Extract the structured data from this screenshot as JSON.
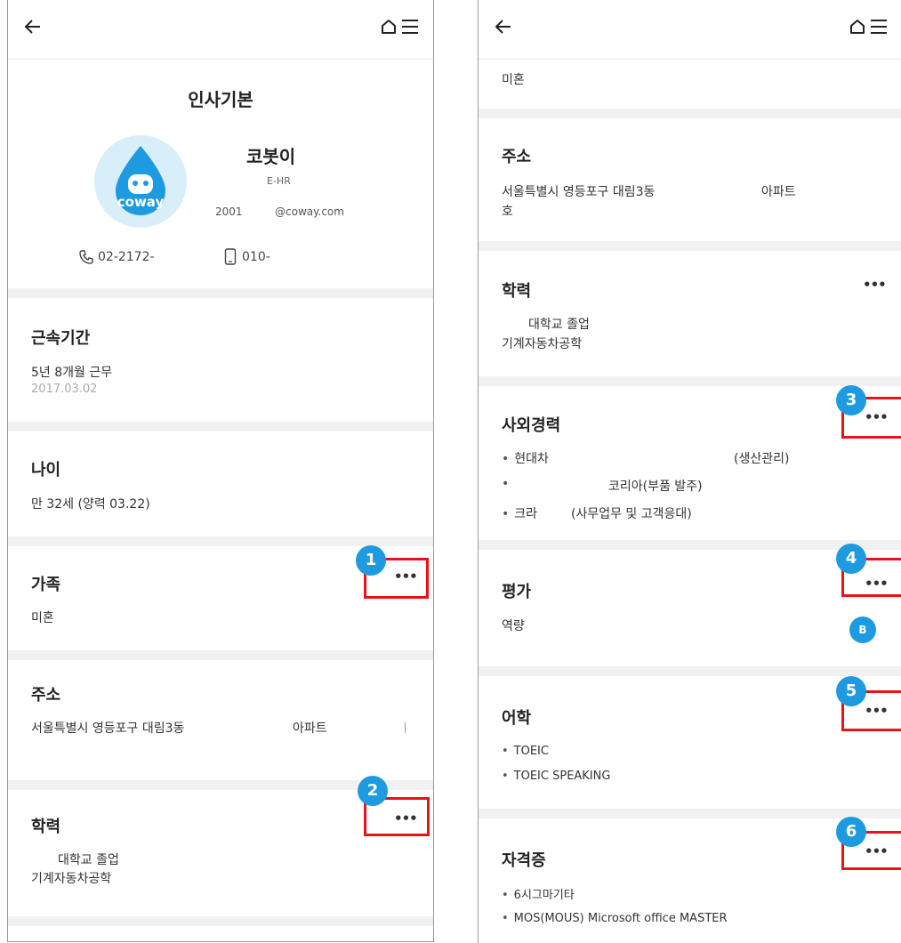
{
  "page_title": "인사기본",
  "profile": {
    "name": "코봇이",
    "dept": "E-HR",
    "emp_no": "2001",
    "email": "@coway.com",
    "phone": "02-2172-",
    "mobile": "010-",
    "logo_text": "coway"
  },
  "sections": {
    "tenure": {
      "title": "근속기간",
      "value": "5년 8개월 근무",
      "date": "2017.03.02"
    },
    "age": {
      "title": "나이",
      "value": "만 32세 (양력 03.22)"
    },
    "family": {
      "title": "가족",
      "value": "미혼"
    },
    "address": {
      "title": "주소",
      "line1": "서울특별시 영등포구 대림3동",
      "line1_apt": "아파트",
      "line2": "호"
    },
    "education": {
      "title": "학력",
      "line1": "대학교 졸업",
      "line2": "기계자동차공학"
    },
    "career": {
      "title": "사외경력",
      "items": [
        {
          "company": "현대차",
          "desc": "(생산관리)"
        },
        {
          "company": "",
          "desc": "코리아(부품 발주)"
        },
        {
          "company": "크라",
          "desc": "(사무업무 및 고객응대)"
        }
      ]
    },
    "evaluation": {
      "title": "평가",
      "label": "역량",
      "grade": "B"
    },
    "language": {
      "title": "어학",
      "items": [
        "TOEIC",
        "TOEIC SPEAKING"
      ]
    },
    "certificate": {
      "title": "자격증",
      "items": [
        "6시그마기타",
        "MOS(MOUS) Microsoft office MASTER"
      ]
    }
  },
  "more_label": "•••",
  "callouts": [
    "1",
    "2",
    "3",
    "4",
    "5",
    "6"
  ],
  "colors": {
    "callout": "#1e9be0",
    "highlight_box": "#e8131a",
    "section_gap": "#f1f1f1"
  }
}
